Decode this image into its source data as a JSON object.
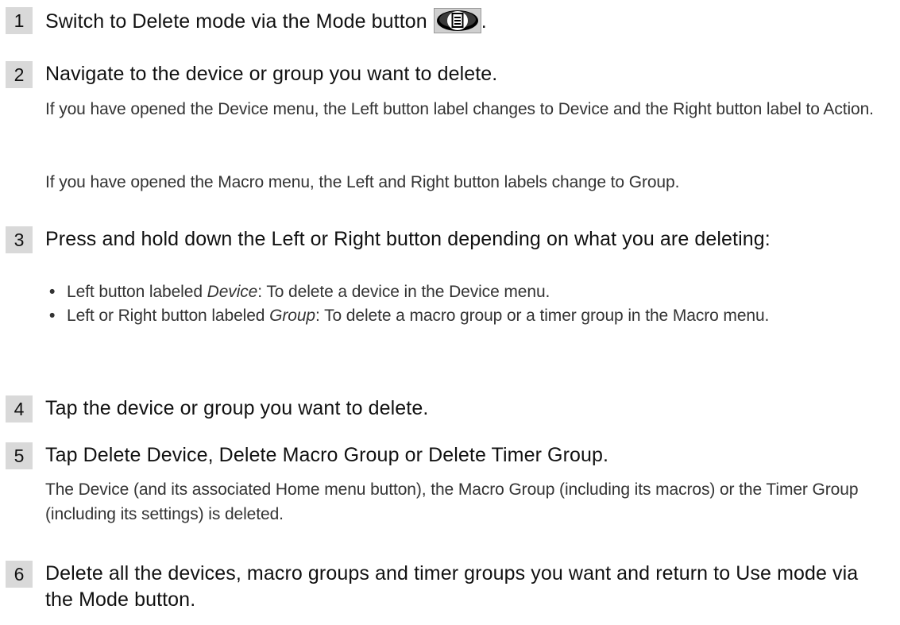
{
  "steps": [
    {
      "number": "1",
      "title_before_icon": "Switch to Delete mode via the Mode button",
      "title_after_icon": ".",
      "icon": "mode-button-icon"
    },
    {
      "number": "2",
      "title": "Navigate to the device or group you want to delete.",
      "paragraphs": [
        "If you have opened the Device menu, the Left button label changes to Device and the Right button label to Action.",
        "If you have opened the Macro menu, the Left and Right button labels change to Group."
      ]
    },
    {
      "number": "3",
      "title": "Press and hold down the Left or Right button depending on what you are deleting:",
      "bullets": [
        {
          "prefix": "Left button labeled ",
          "emphasis": "Device",
          "suffix": ": To delete a device in the Device menu."
        },
        {
          "prefix": "Left or Right button labeled ",
          "emphasis": "Group",
          "suffix": ": To delete a macro group or a timer group in the Macro menu."
        }
      ],
      "bullet_glyph": "•"
    },
    {
      "number": "4",
      "title": "Tap the device or group you want to delete."
    },
    {
      "number": "5",
      "title": "Tap Delete Device, Delete Macro Group or Delete Timer Group.",
      "paragraphs": [
        "The Device (and its associated Home menu button), the Macro Group (including its macros) or the Timer Group (including its settings) is deleted."
      ]
    },
    {
      "number": "6",
      "title": "Delete all the devices, macro groups and timer groups you want and return to Use mode via the Mode button."
    }
  ],
  "colors": {
    "number_box": "#d9d9d9",
    "title_text": "#111111",
    "body_text": "#333333"
  }
}
